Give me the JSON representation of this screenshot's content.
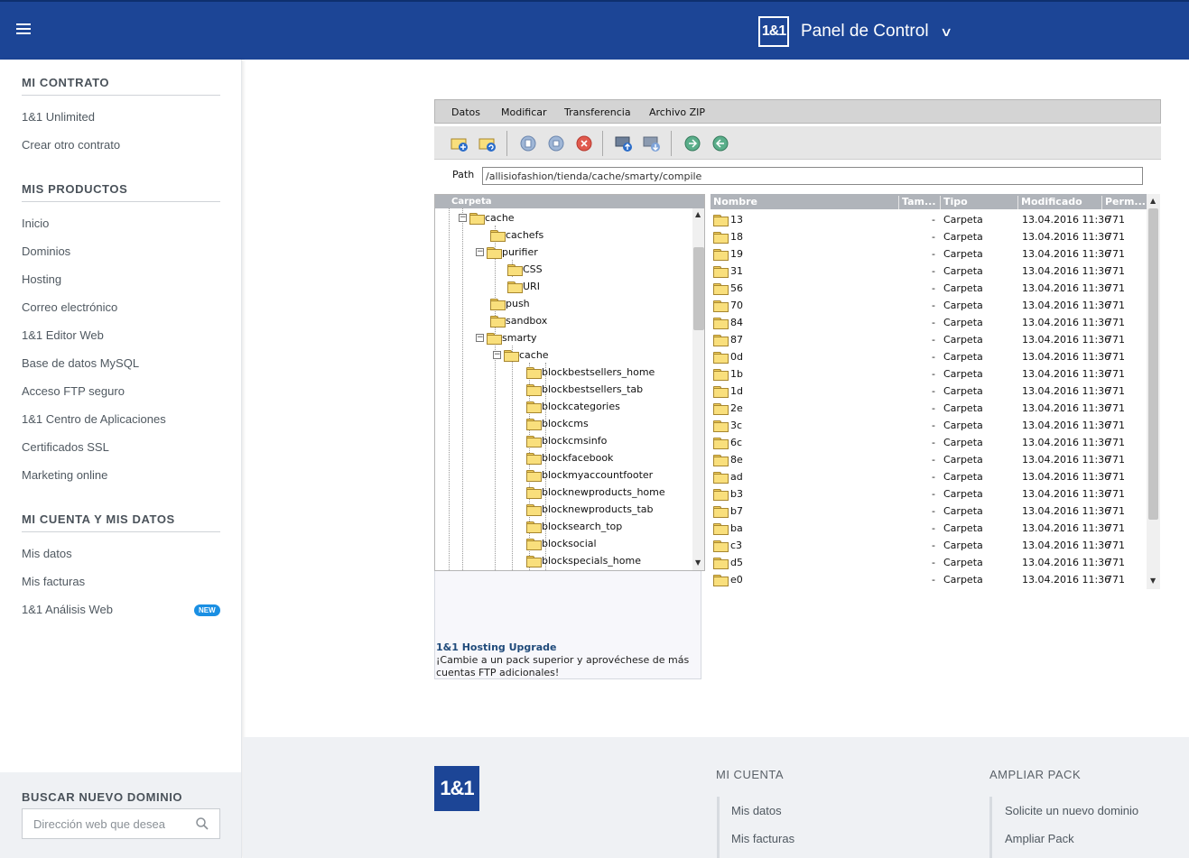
{
  "header": {
    "menu_icon": "hamburger-icon",
    "logo_text": "1&1",
    "title": "Panel de Control"
  },
  "sidebar": {
    "sections": [
      {
        "title": "MI CONTRATO",
        "items": [
          "1&1 Unlimited",
          "Crear otro contrato"
        ]
      },
      {
        "title": "MIS PRODUCTOS",
        "items": [
          "Inicio",
          "Dominios",
          "Hosting",
          "Correo electrónico",
          "1&1 Editor Web",
          "Base de datos MySQL",
          "Acceso FTP seguro",
          "1&1 Centro de Aplicaciones",
          "Certificados SSL",
          "Marketing online"
        ]
      },
      {
        "title": "MI CUENTA Y MIS DATOS",
        "items": [
          "Mis datos",
          "Mis facturas",
          "1&1 Análisis Web"
        ]
      }
    ],
    "new_badge": "NEW",
    "search": {
      "title": "BUSCAR NUEVO DOMINIO",
      "placeholder": "Dirección web que desea"
    }
  },
  "ftp": {
    "menu": [
      "Datos",
      "Modificar",
      "Transferencia",
      "Archivo ZIP"
    ],
    "toolbar_icons": [
      "new-folder-icon",
      "refresh-folder-icon",
      "copy-icon",
      "rename-icon",
      "delete-icon",
      "upload-icon",
      "download-icon",
      "zip-icon",
      "unzip-icon"
    ],
    "path_label": "Path",
    "path_value": "/allisiofashion/tienda/cache/smarty/compile",
    "tree_header": "Carpeta",
    "tree": [
      {
        "label": "cache",
        "level": 0,
        "expanded": true
      },
      {
        "label": "cachefs",
        "level": 1,
        "expanded": null
      },
      {
        "label": "purifier",
        "level": 1,
        "expanded": true
      },
      {
        "label": "CSS",
        "level": 2,
        "expanded": null
      },
      {
        "label": "URI",
        "level": 2,
        "expanded": null
      },
      {
        "label": "push",
        "level": 1,
        "expanded": null
      },
      {
        "label": "sandbox",
        "level": 1,
        "expanded": null
      },
      {
        "label": "smarty",
        "level": 1,
        "expanded": true
      },
      {
        "label": "cache",
        "level": 2,
        "expanded": true
      },
      {
        "label": "blockbestsellers_home",
        "level": 3,
        "expanded": null
      },
      {
        "label": "blockbestsellers_tab",
        "level": 3,
        "expanded": null
      },
      {
        "label": "blockcategories",
        "level": 3,
        "expanded": null
      },
      {
        "label": "blockcms",
        "level": 3,
        "expanded": null
      },
      {
        "label": "blockcmsinfo",
        "level": 3,
        "expanded": null
      },
      {
        "label": "blockfacebook",
        "level": 3,
        "expanded": null
      },
      {
        "label": "blockmyaccountfooter",
        "level": 3,
        "expanded": null
      },
      {
        "label": "blocknewproducts_home",
        "level": 3,
        "expanded": null
      },
      {
        "label": "blocknewproducts_tab",
        "level": 3,
        "expanded": null
      },
      {
        "label": "blocksearch_top",
        "level": 3,
        "expanded": null
      },
      {
        "label": "blocksocial",
        "level": 3,
        "expanded": null
      },
      {
        "label": "blockspecials_home",
        "level": 3,
        "expanded": null
      }
    ],
    "upgrade": {
      "title": "1&1 Hosting Upgrade",
      "text": "¡Cambie a un pack superior y aprovéchese de más cuentas FTP adicionales!"
    },
    "file_columns": [
      "Nombre",
      "Tam...",
      "Tipo",
      "Modificado",
      "Perm..."
    ],
    "files": [
      {
        "name": "13",
        "size": "-",
        "type": "Carpeta",
        "modified": "13.04.2016 11:36",
        "perm": "771"
      },
      {
        "name": "18",
        "size": "-",
        "type": "Carpeta",
        "modified": "13.04.2016 11:36",
        "perm": "771"
      },
      {
        "name": "19",
        "size": "-",
        "type": "Carpeta",
        "modified": "13.04.2016 11:36",
        "perm": "771"
      },
      {
        "name": "31",
        "size": "-",
        "type": "Carpeta",
        "modified": "13.04.2016 11:36",
        "perm": "771"
      },
      {
        "name": "56",
        "size": "-",
        "type": "Carpeta",
        "modified": "13.04.2016 11:36",
        "perm": "771"
      },
      {
        "name": "70",
        "size": "-",
        "type": "Carpeta",
        "modified": "13.04.2016 11:36",
        "perm": "771"
      },
      {
        "name": "84",
        "size": "-",
        "type": "Carpeta",
        "modified": "13.04.2016 11:36",
        "perm": "771"
      },
      {
        "name": "87",
        "size": "-",
        "type": "Carpeta",
        "modified": "13.04.2016 11:36",
        "perm": "771"
      },
      {
        "name": "0d",
        "size": "-",
        "type": "Carpeta",
        "modified": "13.04.2016 11:36",
        "perm": "771"
      },
      {
        "name": "1b",
        "size": "-",
        "type": "Carpeta",
        "modified": "13.04.2016 11:36",
        "perm": "771"
      },
      {
        "name": "1d",
        "size": "-",
        "type": "Carpeta",
        "modified": "13.04.2016 11:36",
        "perm": "771"
      },
      {
        "name": "2e",
        "size": "-",
        "type": "Carpeta",
        "modified": "13.04.2016 11:36",
        "perm": "771"
      },
      {
        "name": "3c",
        "size": "-",
        "type": "Carpeta",
        "modified": "13.04.2016 11:36",
        "perm": "771"
      },
      {
        "name": "6c",
        "size": "-",
        "type": "Carpeta",
        "modified": "13.04.2016 11:36",
        "perm": "771"
      },
      {
        "name": "8e",
        "size": "-",
        "type": "Carpeta",
        "modified": "13.04.2016 11:36",
        "perm": "771"
      },
      {
        "name": "ad",
        "size": "-",
        "type": "Carpeta",
        "modified": "13.04.2016 11:36",
        "perm": "771"
      },
      {
        "name": "b3",
        "size": "-",
        "type": "Carpeta",
        "modified": "13.04.2016 11:36",
        "perm": "771"
      },
      {
        "name": "b7",
        "size": "-",
        "type": "Carpeta",
        "modified": "13.04.2016 11:36",
        "perm": "771"
      },
      {
        "name": "ba",
        "size": "-",
        "type": "Carpeta",
        "modified": "13.04.2016 11:36",
        "perm": "771"
      },
      {
        "name": "c3",
        "size": "-",
        "type": "Carpeta",
        "modified": "13.04.2016 11:36",
        "perm": "771"
      },
      {
        "name": "d5",
        "size": "-",
        "type": "Carpeta",
        "modified": "13.04.2016 11:36",
        "perm": "771"
      },
      {
        "name": "e0",
        "size": "-",
        "type": "Carpeta",
        "modified": "13.04.2016 11:36",
        "perm": "771"
      }
    ]
  },
  "footer": {
    "logo_text": "1&1",
    "col1": {
      "title": "MI CUENTA",
      "items": [
        "Mis datos",
        "Mis facturas"
      ]
    },
    "col2": {
      "title": "AMPLIAR PACK",
      "items": [
        "Solicite un nuevo dominio",
        "Ampliar Pack"
      ]
    }
  },
  "colors": {
    "header_bg": "#1c4596",
    "badge_new": "#1a8fe3",
    "footer_bg": "#eff1f4"
  }
}
